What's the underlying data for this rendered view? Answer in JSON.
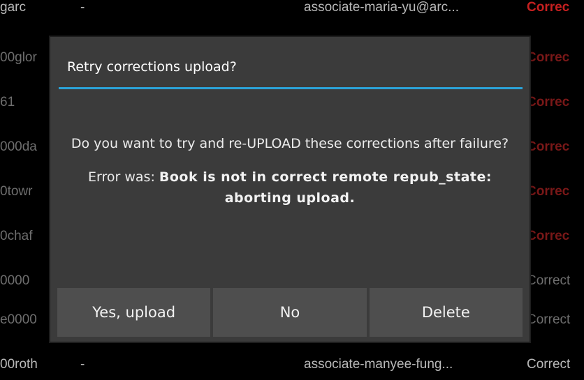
{
  "background_rows": [
    {
      "id": "garc",
      "dash": "-",
      "email": "associate-maria-yu@arc...",
      "status": "Correc"
    },
    {
      "id": "00glor",
      "dash": "",
      "email": "",
      "status": "Correc"
    },
    {
      "id": "61",
      "dash": "",
      "email": "",
      "status": "Correc"
    },
    {
      "id": "000da",
      "dash": "",
      "email": "",
      "status": "Correc"
    },
    {
      "id": "0towr",
      "dash": "",
      "email": "",
      "status": "Correc"
    },
    {
      "id": "0chaf",
      "dash": "",
      "email": "",
      "status": "Correc"
    },
    {
      "id": "0000",
      "dash": "",
      "email": "",
      "status": "Correct"
    },
    {
      "id": "e0000",
      "dash": "",
      "email": "",
      "status": "Correct"
    },
    {
      "id": "00roth",
      "dash": "-",
      "email": "associate-manyee-fung...",
      "status": "Correct"
    }
  ],
  "dialog": {
    "title": "Retry corrections upload?",
    "message": "Do you want to try and re-UPLOAD these corrections after failure?",
    "error_prefix": "Error was: ",
    "error_text": "Book is not in correct remote repub_state: aborting upload.",
    "buttons": {
      "yes": "Yes, upload",
      "no": "No",
      "delete": "Delete"
    }
  },
  "colors": {
    "accent": "#2ba3d9",
    "status_red": "#c62020",
    "dialog_bg": "#3b3b3b",
    "button_bg": "#4e4e4e"
  }
}
